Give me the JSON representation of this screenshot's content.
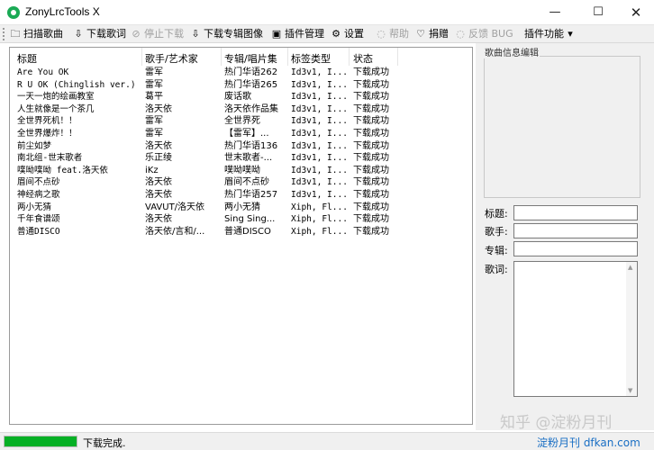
{
  "window": {
    "title": "ZonyLrcTools X",
    "min_glyph": "—",
    "max_glyph": "☐",
    "close_glyph": "✕"
  },
  "toolbar": {
    "items": [
      {
        "label": "扫描歌曲",
        "icon": "folder-icon",
        "glyph": "🗀",
        "enabled": true
      },
      {
        "label": "下载歌词",
        "icon": "download-icon",
        "glyph": "⇩",
        "enabled": true
      },
      {
        "label": "停止下载",
        "icon": "stop-icon",
        "glyph": "⊘",
        "enabled": false
      },
      {
        "label": "下载专辑图像",
        "icon": "download-image-icon",
        "glyph": "⇩",
        "enabled": true
      },
      {
        "label": "插件管理",
        "icon": "plugin-icon",
        "glyph": "▣",
        "enabled": true
      },
      {
        "label": "设置",
        "icon": "gear-icon",
        "glyph": "⚙",
        "enabled": true
      },
      {
        "label": "帮助",
        "icon": "help-icon",
        "glyph": "◌",
        "enabled": false
      },
      {
        "label": "捐赠",
        "icon": "donate-icon",
        "glyph": "♡",
        "enabled": true
      },
      {
        "label": "反馈 BUG",
        "icon": "feedback-icon",
        "glyph": "◌",
        "enabled": false
      },
      {
        "label": "插件功能",
        "icon": "chevron-down-icon",
        "glyph": "▾",
        "enabled": true
      }
    ]
  },
  "list": {
    "columns": [
      "标题",
      "歌手/艺术家",
      "专辑/唱片集",
      "标签类型",
      "状态"
    ],
    "rows": [
      [
        "Are You OK",
        "雷军",
        "热门华语262",
        "Id3v1, I...",
        "下载成功"
      ],
      [
        "R U OK (Chinglish ver.)",
        "雷军",
        "热门华语265",
        "Id3v1, I...",
        "下载成功"
      ],
      [
        "一天一炮的绘画教室",
        "葛平",
        "废话歌",
        "Id3v1, I...",
        "下载成功"
      ],
      [
        "人生就像是一个茶几",
        "洛天依",
        "洛天依作品集",
        "Id3v1, I...",
        "下载成功"
      ],
      [
        "全世界死机！！",
        "雷军",
        "全世界死",
        "Id3v1, I...",
        "下载成功"
      ],
      [
        "全世界爆炸！！",
        "雷军",
        "【雷军】...",
        "Id3v1, I...",
        "下载成功"
      ],
      [
        "前尘如梦",
        "洛天依",
        "热门华语136",
        "Id3v1, I...",
        "下载成功"
      ],
      [
        "南北组-世末歌者",
        "乐正绫",
        "世末歌者-...",
        "Id3v1, I...",
        "下载成功"
      ],
      [
        "噗呦噗呦  feat.洛天依",
        "iKz",
        "噗呦噗呦",
        "Id3v1, I...",
        "下载成功"
      ],
      [
        "眉间不点砂",
        "洛天依",
        "眉间不点砂",
        "Id3v1, I...",
        "下载成功"
      ],
      [
        "神经病之歌",
        "洛天依",
        "热门华语257",
        "Id3v1, I...",
        "下载成功"
      ],
      [
        "两小无猜",
        "VAVUT/洛天依",
        "两小无猜",
        "Xiph, Fl...",
        "下载成功"
      ],
      [
        "千年食谱颂",
        "洛天依",
        "Sing Sing...",
        "Xiph, Fl...",
        "下载成功"
      ],
      [
        "普通DISCO",
        "洛天依/言和/...",
        "普通DISCO",
        "Xiph, Fl...",
        "下载成功"
      ]
    ]
  },
  "editor": {
    "group_title": "歌曲信息编辑",
    "title_label": "标题:",
    "artist_label": "歌手:",
    "album_label": "专辑:",
    "lyrics_label": "歌词:",
    "title_value": "",
    "artist_value": "",
    "album_value": "",
    "lyrics_value": ""
  },
  "status": {
    "text": "下载完成.",
    "progress": 1.0,
    "progress_color": "#06b025"
  },
  "watermark": {
    "line1": "知乎 @淀粉月刊",
    "line2": "淀粉月刊 dfkan.com"
  }
}
